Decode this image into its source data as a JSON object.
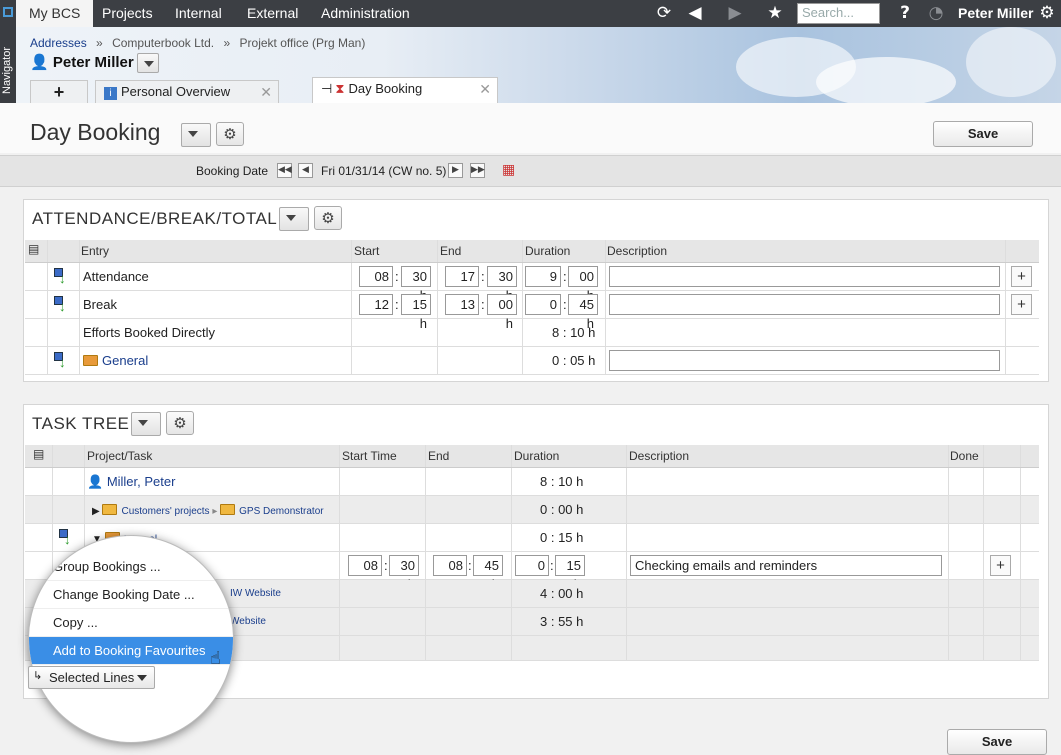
{
  "topbar": {
    "menus": [
      "My BCS",
      "Projects",
      "Internal",
      "External",
      "Administration"
    ],
    "search_placeholder": "Search...",
    "user": "Peter Miller",
    "help": "?"
  },
  "navigator": {
    "label": "Navigator"
  },
  "breadcrumb": [
    "Addresses",
    "»",
    "Computerbook Ltd.",
    "»",
    "Projekt office (Prg Man)"
  ],
  "header_user": "Peter Miller",
  "tabs": [
    {
      "label": "+"
    },
    {
      "label": "Personal Overview"
    },
    {
      "label": "Day Booking"
    }
  ],
  "page": {
    "title": "Day Booking",
    "save": "Save"
  },
  "date_bar": {
    "label": "Booking Date",
    "value": "Fri 01/31/14 (CW no. 5)"
  },
  "attendance": {
    "title": "ATTENDANCE/BREAK/TOTAL",
    "columns": [
      "Entry",
      "Start",
      "End",
      "Duration",
      "Description"
    ],
    "rows": [
      {
        "entry": "Attendance",
        "start_h": "08",
        "start_m": "30",
        "end_h": "17",
        "end_m": "30",
        "dur_h": "9",
        "dur_m": "00"
      },
      {
        "entry": "Break",
        "start_h": "12",
        "start_m": "15",
        "end_h": "13",
        "end_m": "00",
        "dur_h": "0",
        "dur_m": "45"
      },
      {
        "entry": "Efforts Booked Directly",
        "duration": "8 : 10 h"
      },
      {
        "entry": "General",
        "duration": "0 : 05 h"
      }
    ]
  },
  "task_tree": {
    "title": "TASK TREE",
    "columns": [
      "Project/Task",
      "Start Time",
      "End",
      "Duration",
      "Description",
      "Done"
    ],
    "rows": [
      {
        "task": "Miller, Peter",
        "duration": "8 : 10 h"
      },
      {
        "path": [
          "Customers' projects",
          "GPS Demonstrator"
        ],
        "duration": "0 : 00 h"
      },
      {
        "task": "Internal",
        "duration": "0 : 15 h"
      },
      {
        "start_h": "08",
        "start_m": "30",
        "end_h": "08",
        "end_m": "45",
        "dur_h": "0",
        "dur_m": "15",
        "description": "Checking emails and reminders"
      },
      {
        "task": "IW Website",
        "duration": "4 : 00 h"
      },
      {
        "task": "Website",
        "duration": "3 : 55 h"
      }
    ]
  },
  "context_menu": {
    "items": [
      "Group Bookings ...",
      "Change Booking Date ...",
      "Copy ...",
      "Add to Booking Favourites"
    ],
    "selected_lines": "Selected Lines"
  },
  "footer": {
    "save": "Save"
  },
  "unit_h": "h"
}
